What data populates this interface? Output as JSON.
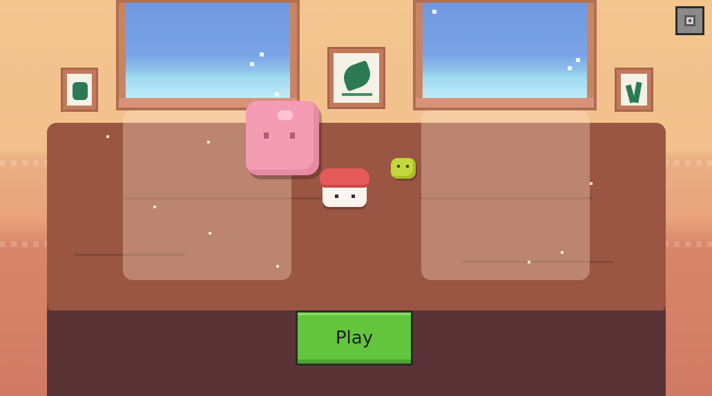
{
  "scene": {
    "name": "sushi-table-title-screen",
    "colors": {
      "wall": "#f2c08c",
      "table": "#9a5642",
      "table_front": "#5a3336",
      "play_button": "#63c43e",
      "pink_blob": "#f39cb4",
      "sushi_fish": "#e45a5a",
      "wasabi": "#c3d83a"
    }
  },
  "buttons": {
    "play_label": "Play",
    "settings_icon": "gear-icon"
  },
  "characters": [
    "pink-mochi-blob",
    "salmon-sushi",
    "wasabi-blob"
  ],
  "decor": {
    "windows": 2,
    "frames": [
      "leaf-frame-left",
      "leaf-frame-center",
      "grass-frame-right"
    ]
  }
}
